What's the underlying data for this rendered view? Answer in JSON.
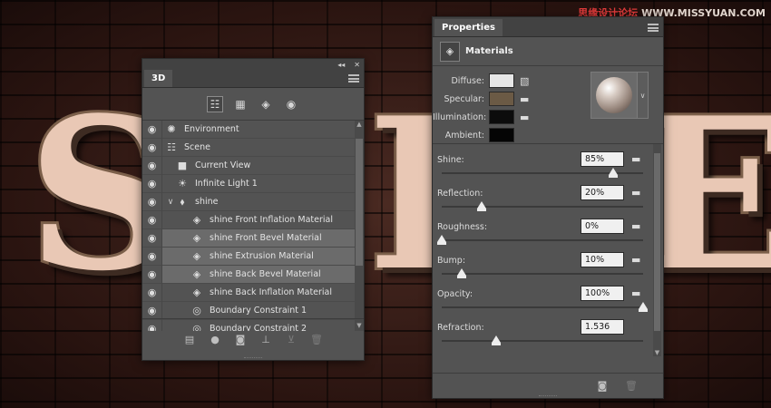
{
  "background": {
    "letters": [
      "S",
      "I",
      "E"
    ],
    "watermark_part1": "思缘设计论坛",
    "watermark_part2": "WWW.MISSYUAN.COM"
  },
  "panel_3d": {
    "tab_label": "3D",
    "collapse_label": "◂◂",
    "close_label": "✕",
    "filters": [
      {
        "icon": "scene-filter-icon",
        "glyph": "☷",
        "active": true
      },
      {
        "icon": "mesh-filter-icon",
        "glyph": "▦",
        "active": false
      },
      {
        "icon": "material-filter-icon",
        "glyph": "◈",
        "active": false
      },
      {
        "icon": "light-filter-icon",
        "glyph": "◉",
        "active": false
      }
    ],
    "items": [
      {
        "label": "Environment",
        "icon": "environment-icon",
        "glyph": "✺",
        "indent": 0,
        "selected": false,
        "arrow": ""
      },
      {
        "label": "Scene",
        "icon": "scene-icon",
        "glyph": "☷",
        "indent": 0,
        "selected": false,
        "arrow": ""
      },
      {
        "label": "Current View",
        "icon": "camera-icon",
        "glyph": "■",
        "indent": 1,
        "selected": false,
        "arrow": ""
      },
      {
        "label": "Infinite Light 1",
        "icon": "light-icon",
        "glyph": "☀",
        "indent": 1,
        "selected": false,
        "arrow": ""
      },
      {
        "label": "shine",
        "icon": "mesh-icon",
        "glyph": "⬧",
        "indent": 1,
        "selected": false,
        "arrow": "∨"
      },
      {
        "label": "shine Front Inflation Material",
        "icon": "material-icon",
        "glyph": "◈",
        "indent": 2,
        "selected": false,
        "arrow": ""
      },
      {
        "label": "shine Front Bevel Material",
        "icon": "material-icon",
        "glyph": "◈",
        "indent": 2,
        "selected": true,
        "arrow": ""
      },
      {
        "label": "shine Extrusion Material",
        "icon": "material-icon",
        "glyph": "◈",
        "indent": 2,
        "selected": true,
        "arrow": ""
      },
      {
        "label": "shine Back Bevel Material",
        "icon": "material-icon",
        "glyph": "◈",
        "indent": 2,
        "selected": true,
        "arrow": ""
      },
      {
        "label": "shine Back Inflation Material",
        "icon": "material-icon",
        "glyph": "◈",
        "indent": 2,
        "selected": false,
        "arrow": ""
      },
      {
        "label": "Boundary Constraint 1",
        "icon": "constraint-icon",
        "glyph": "◎",
        "indent": 2,
        "selected": false,
        "arrow": ""
      },
      {
        "label": "Boundary Constraint 2",
        "icon": "constraint-icon",
        "glyph": "◎",
        "indent": 2,
        "selected": false,
        "arrow": ""
      }
    ],
    "bottom_icons": [
      {
        "icon": "add-mesh-icon",
        "glyph": "▤",
        "dim": false
      },
      {
        "icon": "add-light-icon",
        "glyph": "●",
        "dim": false
      },
      {
        "icon": "render-icon",
        "glyph": "◙",
        "dim": false
      },
      {
        "icon": "drop-to-plane-icon",
        "glyph": "⊥",
        "dim": false
      },
      {
        "icon": "constraint-tool-icon",
        "glyph": "⊻",
        "dim": true
      },
      {
        "icon": "trash-icon",
        "glyph": "🗑",
        "dim": true
      }
    ]
  },
  "properties": {
    "tab_label": "Properties",
    "header_label": "Materials",
    "swatches": [
      {
        "label": "Diffuse:",
        "color": "#e6e6e6",
        "icon": "texture-file-icon"
      },
      {
        "label": "Specular:",
        "color": "#6b5a45",
        "icon": "folder-icon"
      },
      {
        "label": "Illumination:",
        "color": "#0c0c0c",
        "icon": "folder-icon"
      },
      {
        "label": "Ambient:",
        "color": "#050505",
        "icon": ""
      }
    ],
    "sliders": [
      {
        "label": "Shine:",
        "value": "85%",
        "pos": 0.85,
        "folder": true
      },
      {
        "label": "Reflection:",
        "value": "20%",
        "pos": 0.2,
        "folder": true
      },
      {
        "label": "Roughness:",
        "value": "0%",
        "pos": 0.0,
        "folder": true
      },
      {
        "label": "Bump:",
        "value": "10%",
        "pos": 0.1,
        "folder": true
      },
      {
        "label": "Opacity:",
        "value": "100%",
        "pos": 1.0,
        "folder": true
      },
      {
        "label": "Refraction:",
        "value": "1.536",
        "pos": 0.27,
        "folder": false
      }
    ]
  }
}
